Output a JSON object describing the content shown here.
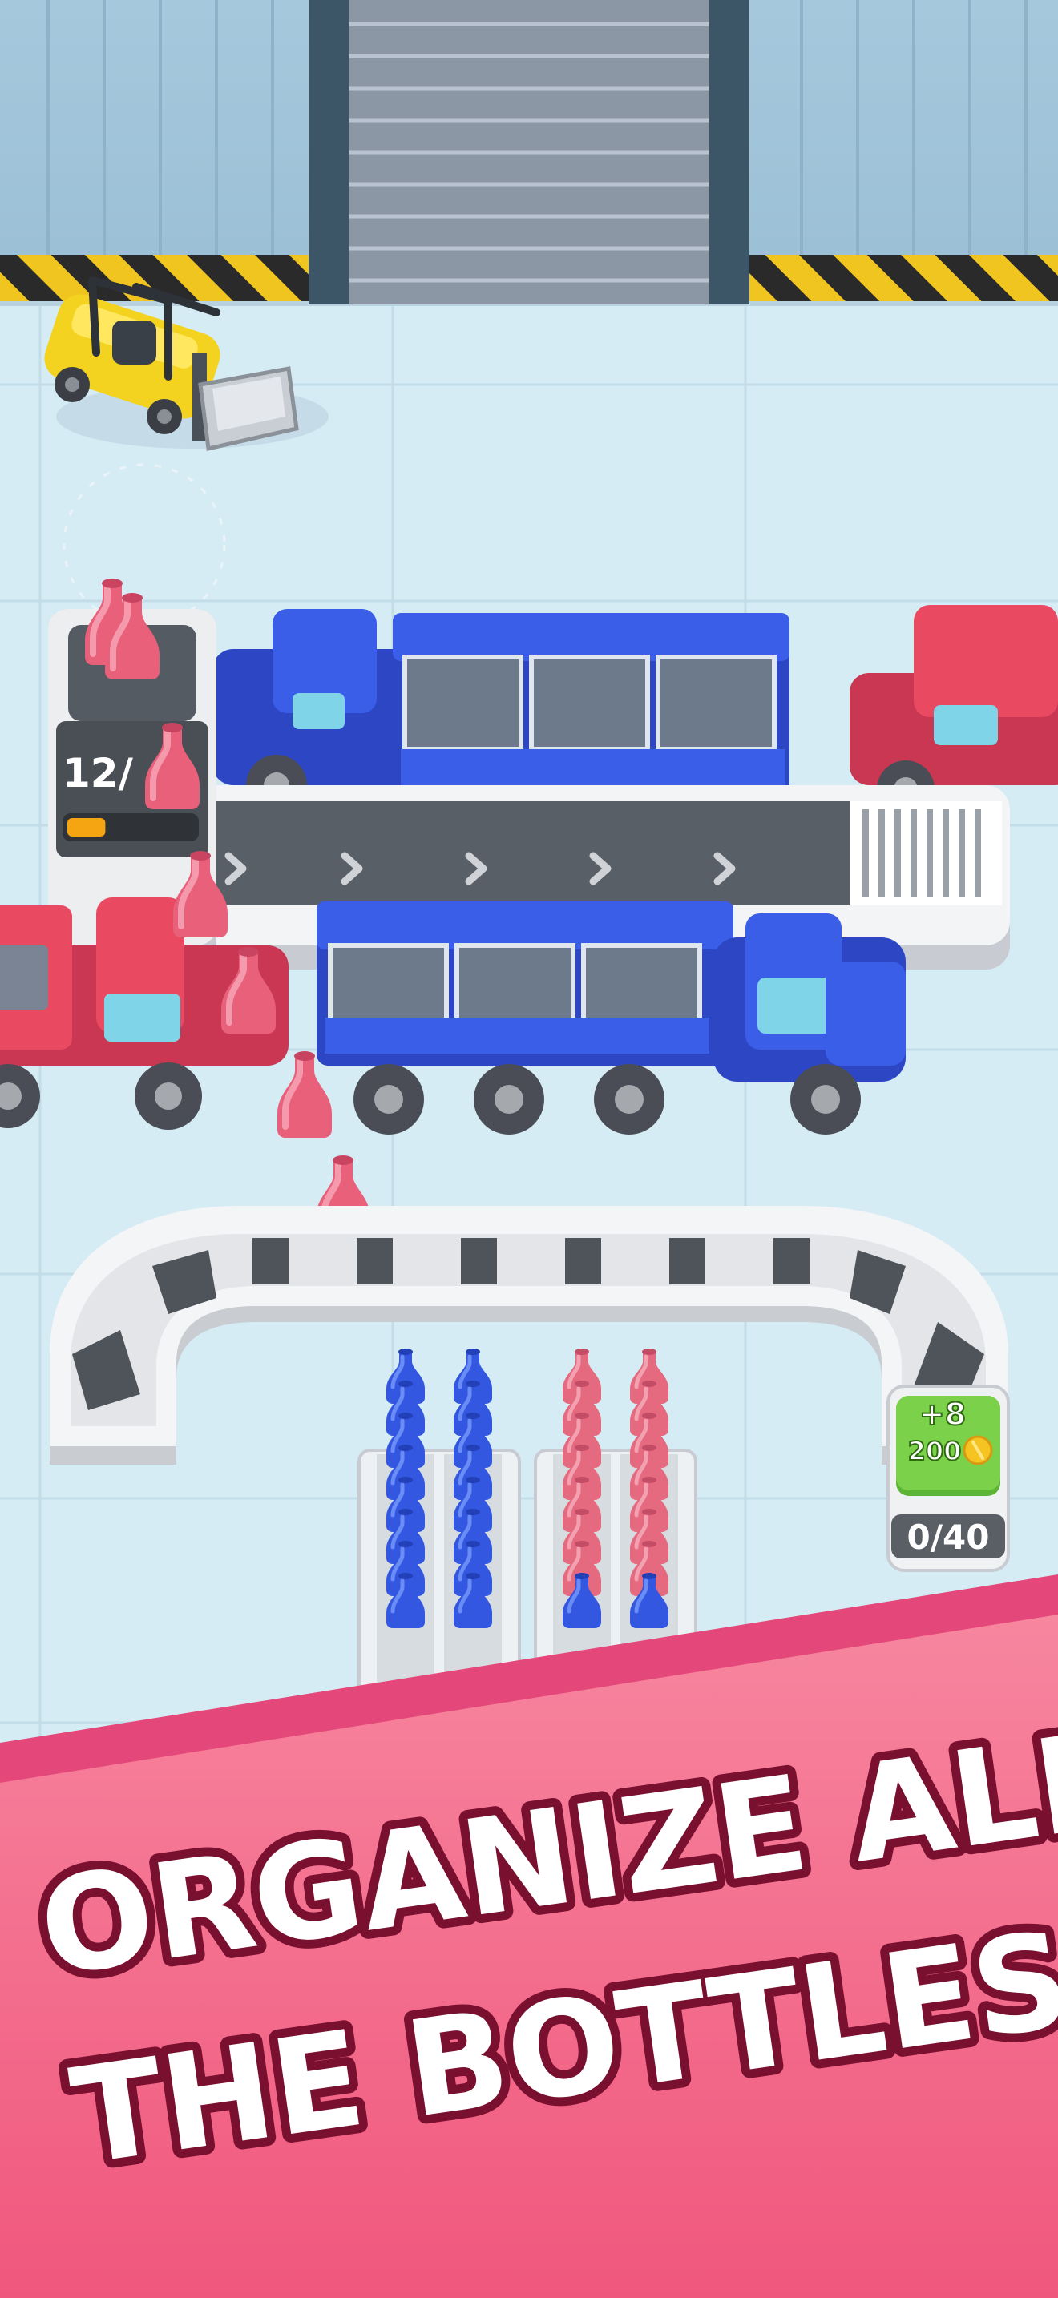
{
  "game": {
    "machine_counter": "12/",
    "machine_progress": 0.3,
    "order": {
      "bonus_label": "+8",
      "reward_value": "200",
      "progress_text": "0/40"
    },
    "headline": {
      "line1": "ORGANIZE ALL",
      "line2": "THE BOTTLES !"
    },
    "colors": {
      "bottle_pink": "#e8607a",
      "bottle_blue": "#3a5ee8",
      "truck_blue": "#3a5ee8",
      "truck_red": "#e94a62",
      "banner_pink": "#f56c8e",
      "reward_green": "#7bd24a",
      "floor": "#d6ecf4"
    },
    "icons": {
      "forklift": "forklift-icon",
      "coin": "coin-icon",
      "conveyor_arrow": "chevron-right-icon"
    },
    "bins": [
      {
        "color": "blue",
        "columns": [
          {
            "stack": "blue",
            "count": 8
          },
          {
            "stack": "blue",
            "count": 8
          }
        ]
      },
      {
        "color": "pink",
        "columns": [
          {
            "stack": "pink",
            "count": 7,
            "extra": "blue"
          },
          {
            "stack": "pink",
            "count": 7,
            "extra": "blue"
          }
        ]
      }
    ]
  }
}
